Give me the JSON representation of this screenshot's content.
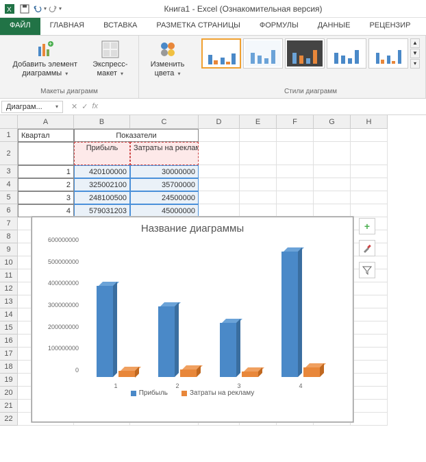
{
  "title": "Книга1 - Excel (Ознакомительная версия)",
  "tabs": [
    "ФАЙЛ",
    "ГЛАВНАЯ",
    "ВСТАВКА",
    "РАЗМЕТКА СТРАНИЦЫ",
    "ФОРМУЛЫ",
    "ДАННЫЕ",
    "РЕЦЕНЗИР"
  ],
  "ribbon": {
    "add_element": "Добавить элемент диаграммы",
    "express_layout": "Экспресс-макет",
    "change_colors": "Изменить цвета",
    "group_layouts": "Макеты диаграмм",
    "group_styles": "Стили диаграмм"
  },
  "namebox": "Диаграм...",
  "columns": [
    "A",
    "B",
    "C",
    "D",
    "E",
    "F",
    "G",
    "H"
  ],
  "rows": [
    "1",
    "2",
    "3",
    "4",
    "5",
    "6",
    "7",
    "8",
    "9",
    "10",
    "11",
    "12",
    "13",
    "14",
    "15",
    "16",
    "17",
    "18",
    "19",
    "20",
    "21",
    "22"
  ],
  "cells": {
    "a1": "Квартал",
    "bc1": "Показатели",
    "b2": "Прибыль",
    "c2": "Затраты на рекламу",
    "a3": "1",
    "b3": "420100000",
    "c3": "30000000",
    "a4": "2",
    "b4": "325002100",
    "c4": "35700000",
    "a5": "3",
    "b5": "248100500",
    "c5": "24500000",
    "a6": "4",
    "b6": "579031203",
    "c6": "45000000"
  },
  "chart_data": {
    "type": "bar",
    "title": "Название диаграммы",
    "categories": [
      "1",
      "2",
      "3",
      "4"
    ],
    "series": [
      {
        "name": "Прибыль",
        "values": [
          420100000,
          325002100,
          248100500,
          579031203
        ],
        "color": "#4a89c8"
      },
      {
        "name": "Затраты на рекламу",
        "values": [
          30000000,
          35700000,
          24500000,
          45000000
        ],
        "color": "#e8873a"
      }
    ],
    "ylim": [
      0,
      600000000
    ],
    "yticks": [
      0,
      100000000,
      200000000,
      300000000,
      400000000,
      500000000,
      600000000
    ],
    "xlabel": "",
    "ylabel": ""
  },
  "side_buttons": {
    "plus": "+",
    "brush": "",
    "filter": ""
  }
}
